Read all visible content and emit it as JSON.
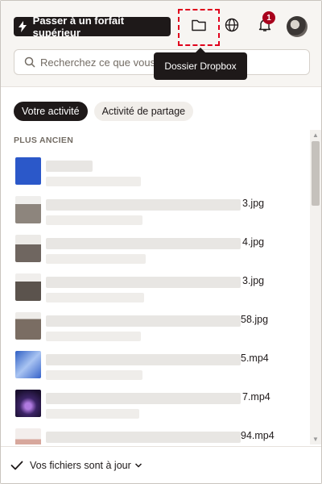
{
  "header": {
    "upgrade_label": "Passer à un forfait supérieur",
    "notification_count": "1",
    "tooltip": "Dossier Dropbox"
  },
  "search": {
    "placeholder": "Recherchez ce que vous v"
  },
  "tabs": [
    {
      "label": "Votre activité",
      "active": true
    },
    {
      "label": "Activité de partage",
      "active": false
    }
  ],
  "section_title": "PLUS ANCIEN",
  "items": [
    {
      "name": "",
      "thumb_color": "#2b58c9"
    },
    {
      "name": "3.jpg",
      "thumb_color": "#8d857d"
    },
    {
      "name": "4.jpg",
      "thumb_color": "#6f6660"
    },
    {
      "name": "3.jpg",
      "thumb_color": "#5b534d"
    },
    {
      "name": "58.jpg",
      "thumb_color": "#7a6d63"
    },
    {
      "name": "5.mp4",
      "thumb_color": "#6d93d9"
    },
    {
      "name": "7.mp4",
      "thumb_color": "#3c2466"
    },
    {
      "name": "94.mp4",
      "thumb_color": "#d7a79c"
    }
  ],
  "footer": {
    "status": "Vos fichiers sont à jour"
  }
}
